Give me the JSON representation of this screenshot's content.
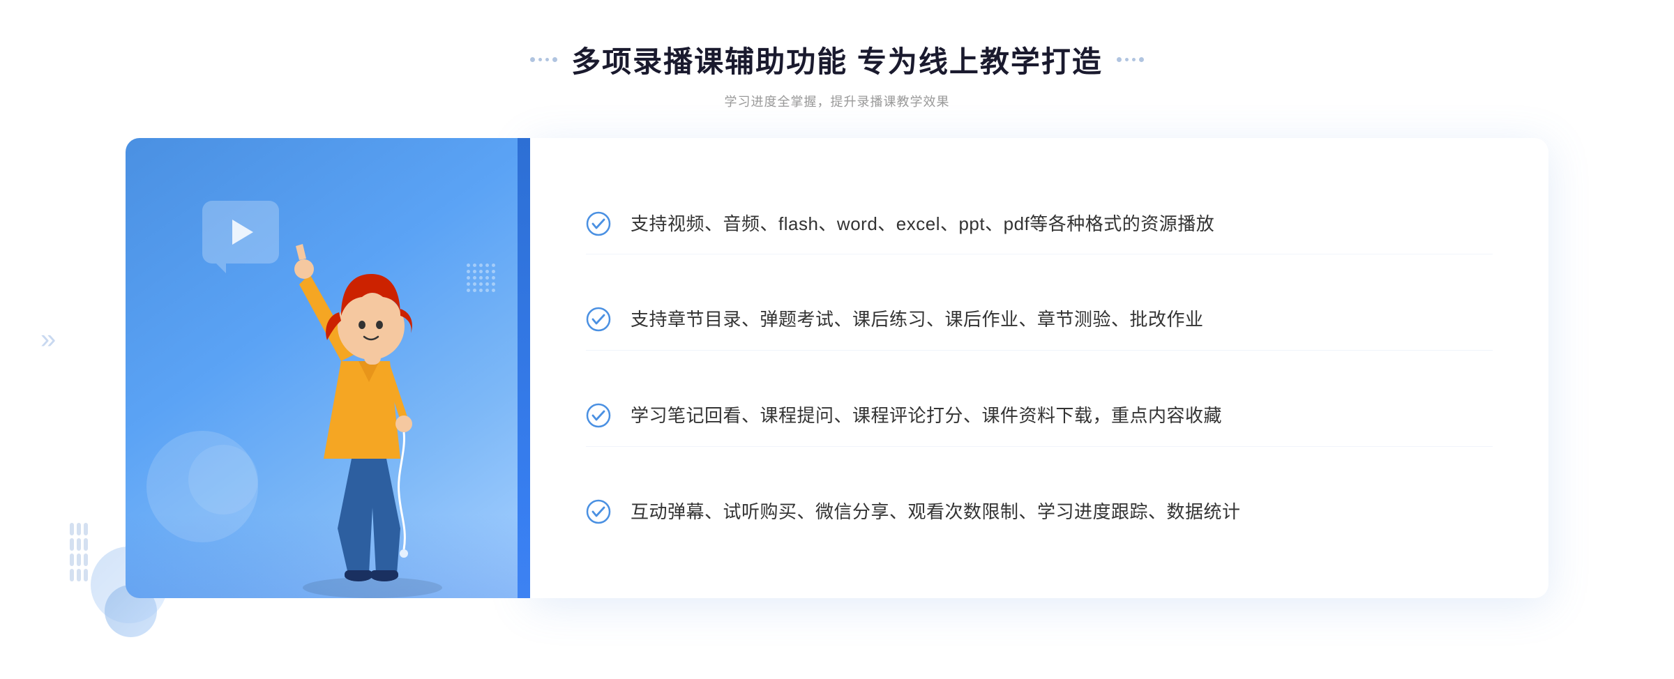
{
  "page": {
    "background": "#ffffff"
  },
  "header": {
    "main_title": "多项录播课辅助功能 专为线上教学打造",
    "sub_title": "学习进度全掌握，提升录播课教学效果"
  },
  "features": [
    {
      "id": 1,
      "text": "支持视频、音频、flash、word、excel、ppt、pdf等各种格式的资源播放"
    },
    {
      "id": 2,
      "text": "支持章节目录、弹题考试、课后练习、课后作业、章节测验、批改作业"
    },
    {
      "id": 3,
      "text": "学习笔记回看、课程提问、课程评论打分、课件资料下载，重点内容收藏"
    },
    {
      "id": 4,
      "text": "互动弹幕、试听购买、微信分享、观看次数限制、学习进度跟踪、数据统计"
    }
  ],
  "icons": {
    "check": "check-circle",
    "play": "play-triangle",
    "left_arrow": "«"
  },
  "colors": {
    "primary_blue": "#4a90e2",
    "light_blue": "#5ba3f5",
    "title_color": "#1a1a2e",
    "text_color": "#333333",
    "subtitle_color": "#999999",
    "check_color": "#4a90e2",
    "border_color": "#f0f4fb"
  }
}
